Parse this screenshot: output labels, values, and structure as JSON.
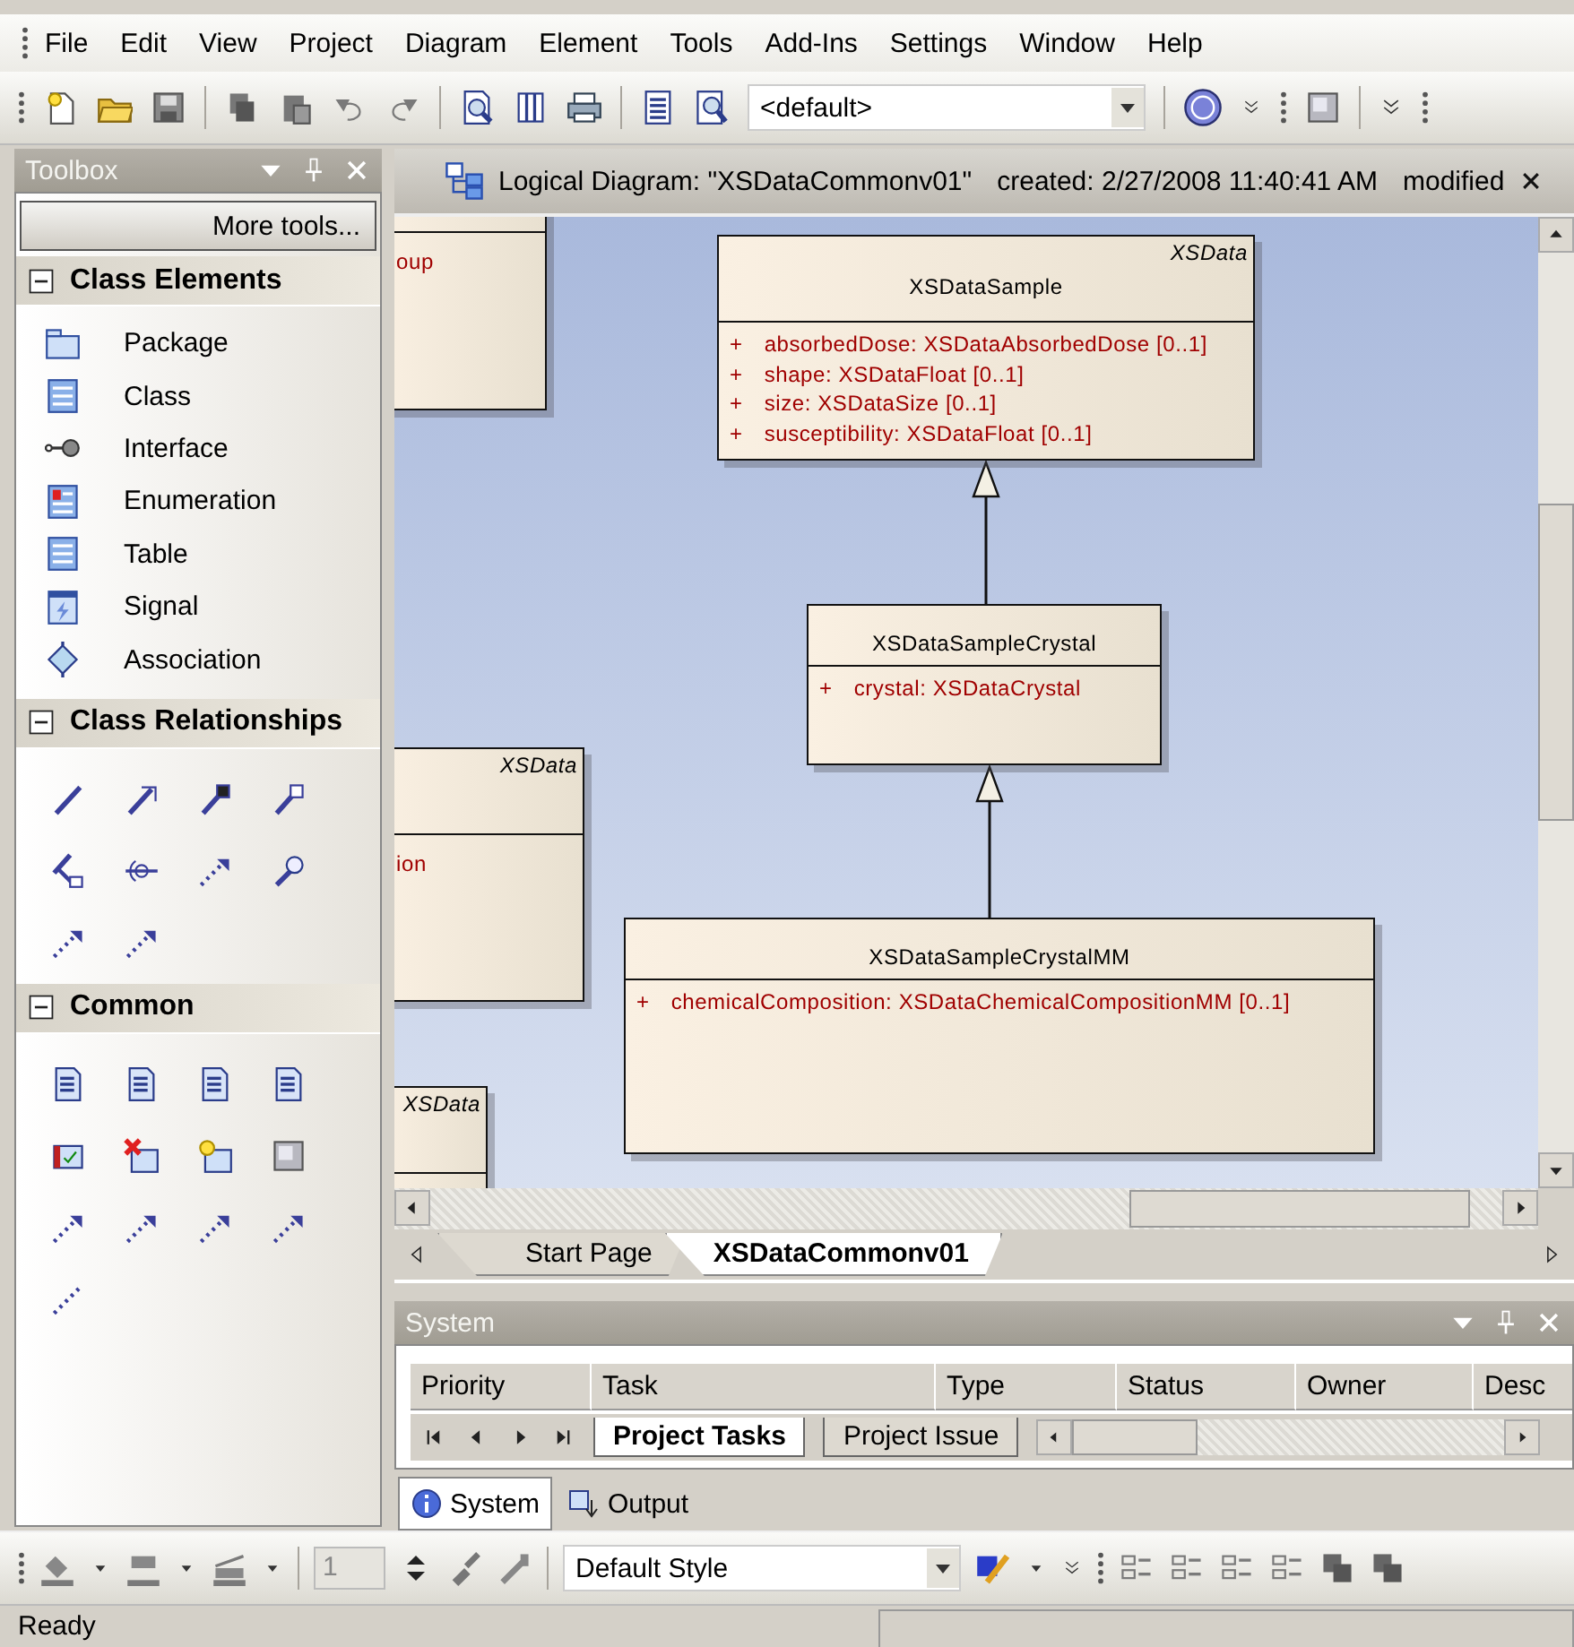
{
  "menu": [
    "File",
    "Edit",
    "View",
    "Project",
    "Diagram",
    "Element",
    "Tools",
    "Add-Ins",
    "Settings",
    "Window",
    "Help"
  ],
  "toolbar": {
    "combo": "<default>"
  },
  "toolbox": {
    "title": "Toolbox",
    "more_tools": "More tools...",
    "sections": [
      {
        "title": "Class Elements",
        "kind": "elements",
        "expanded": true,
        "items": [
          {
            "label": "Package"
          },
          {
            "label": "Class"
          },
          {
            "label": "Interface"
          },
          {
            "label": "Enumeration"
          },
          {
            "label": "Table"
          },
          {
            "label": "Signal"
          },
          {
            "label": "Association"
          }
        ]
      },
      {
        "title": "Class Relationships",
        "kind": "relationships",
        "expanded": true
      },
      {
        "title": "Common",
        "kind": "common",
        "expanded": true
      }
    ]
  },
  "diagram": {
    "title": "Logical Diagram: \"XSDataCommonv01\"",
    "created": "created: 2/27/2008 11:40:41 AM",
    "modified": "modified",
    "classes": [
      {
        "stereotype": "XSData",
        "name": "XSDataSample",
        "attributes": [
          {
            "visibility": "+",
            "text": "absorbedDose: XSDataAbsorbedDose [0..1]"
          },
          {
            "visibility": "+",
            "text": "shape: XSDataFloat [0..1]"
          },
          {
            "visibility": "+",
            "text": "size: XSDataSize [0..1]"
          },
          {
            "visibility": "+",
            "text": "susceptibility: XSDataFloat [0..1]"
          }
        ]
      },
      {
        "name": "XSDataSampleCrystal",
        "attributes": [
          {
            "visibility": "+",
            "text": "crystal: XSDataCrystal"
          }
        ]
      },
      {
        "name": "XSDataSampleCrystalMM",
        "attributes": [
          {
            "visibility": "+",
            "text": "chemicalComposition: XSDataChemicalCompositionMM [0..1]"
          }
        ]
      }
    ],
    "partial_classes": [
      {
        "text": "oup"
      },
      {
        "stereotype": "XSData",
        "text": "ion"
      },
      {
        "stereotype": "XSData"
      }
    ]
  },
  "document_tabs": [
    {
      "label": "Start Page",
      "selected": false
    },
    {
      "label": "XSDataCommonv01",
      "selected": true
    }
  ],
  "system": {
    "title": "System",
    "columns": [
      "Priority",
      "Task",
      "Type",
      "Status",
      "Owner",
      "Desc"
    ],
    "sheet_tabs": [
      {
        "label": "Project Tasks",
        "selected": true
      },
      {
        "label": "Project Issue",
        "selected": false
      }
    ],
    "tabs": [
      {
        "label": "System",
        "selected": true
      },
      {
        "label": "Output",
        "selected": false
      }
    ]
  },
  "format_toolbar": {
    "size": "1",
    "style": "Default Style"
  },
  "status_bar": "Ready"
}
